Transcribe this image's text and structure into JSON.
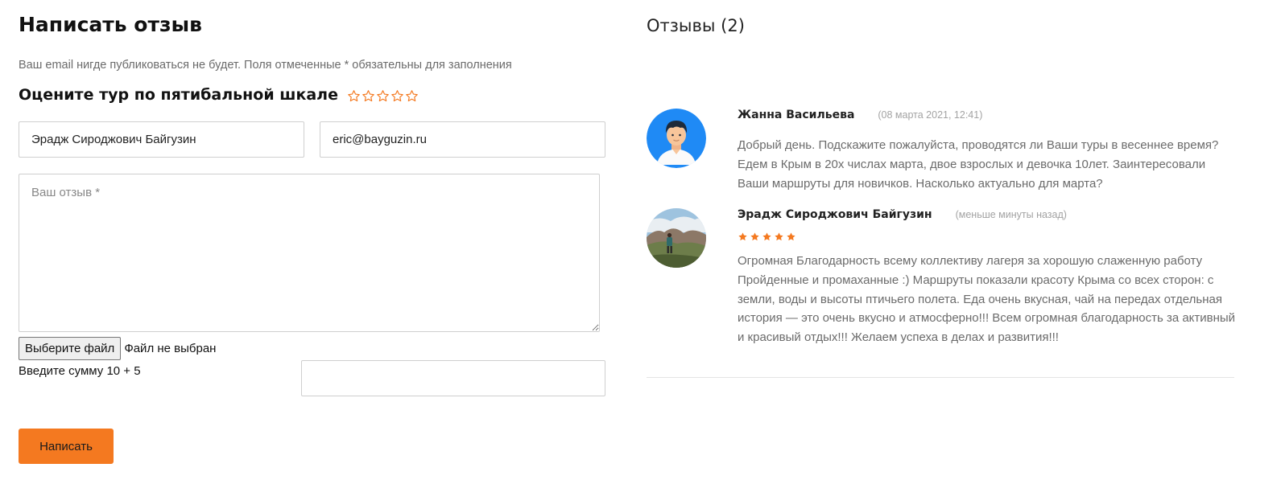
{
  "form": {
    "title": "Написать отзыв",
    "notice": "Ваш email нигде публиковаться не будет. Поля отмеченные * обязательны для заполнения",
    "rating_label": "Оцените тур по пятибальной шкале",
    "rating_star_count": 5,
    "rating_value": 0,
    "name_value": "Эрадж Сироджович Байгузин",
    "email_value": "eric@bayguzin.ru",
    "review_placeholder": "Ваш отзыв *",
    "file_button_label": "Выберите файл",
    "file_status": "Файл не выбран",
    "captcha_label": "Введите сумму 10 + 5",
    "captcha_value": "",
    "submit_label": "Написать"
  },
  "reviews": {
    "title": "Отзывы (2)",
    "items": [
      {
        "author": "Жанна Васильева",
        "date": "(08 марта 2021, 12:41)",
        "avatar_icon": "user-avatar-icon",
        "rating": 0,
        "text": "Добрый день. Подскажите пожалуйста, проводятся ли Ваши туры в весеннее время? Едем в Крым в 20х числах марта, двое взрослых и девочка 10лет. Заинтересовали Ваши маршруты для новичков. Насколько актуально для марта?"
      },
      {
        "author": "Эрадж Сироджович Байгузин",
        "date": "(меньше минуты назад)",
        "avatar_icon": "hiker-photo-avatar",
        "rating": 5,
        "text": "Огромная Благодарность всему коллективу лагеря за хорошую слаженную работу Пройденные и промаханные :) Маршруты показали красоту Крыма со всех сторон: с земли, воды и высоты птичьего полета. Еда очень вкусная, чай на передах отдельная история — это очень вкусно и атмосферно!!! Всем огромная благодарность за активный и красивый отдых!!! Желаем успеха в делах и развития!!!"
      }
    ]
  },
  "colors": {
    "accent": "#f47920",
    "text_muted": "#6b6b6b",
    "date_gray": "#a3a3a3",
    "avatar_blue": "#1f8af5"
  }
}
